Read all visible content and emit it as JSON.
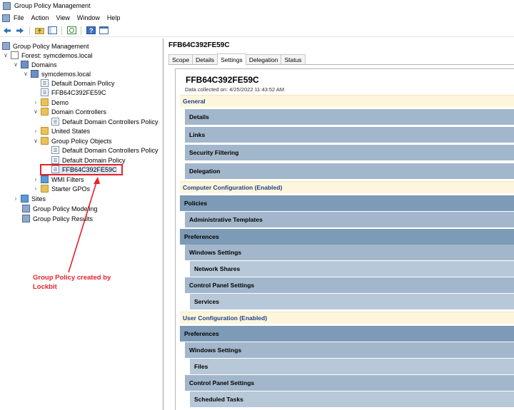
{
  "app": {
    "title": "Group Policy Management"
  },
  "menu": [
    "File",
    "Action",
    "View",
    "Window",
    "Help"
  ],
  "toolbar": {
    "icons": [
      "back-icon",
      "forward-icon",
      "up-folder-icon",
      "show-tree-icon",
      "refresh-icon",
      "help-icon",
      "properties-icon"
    ]
  },
  "tree": {
    "root": "Group Policy Management",
    "forest": "Forest: symcdemos.local",
    "domains": "Domains",
    "domain": "symcdemos.local",
    "default_domain_policy": "Default Domain Policy",
    "gpo_link": "FFB64C392FE59C",
    "demo": "Demo",
    "domain_controllers": "Domain Controllers",
    "default_dc_policy": "Default Domain Controllers Policy",
    "united_states": "United States",
    "gpo_container": "Group Policy Objects",
    "gpo_dc_policy": "Default Domain Controllers Policy",
    "gpo_domain_policy": "Default Domain Policy",
    "gpo_selected": "FFB64C392FE59C",
    "wmi_filters": "WMI Filters",
    "starter_gpos": "Starter GPOs",
    "sites": "Sites",
    "modeling": "Group Policy Modeling",
    "results": "Group Policy Results"
  },
  "annotation": {
    "text": "Group Policy created by Lockbit",
    "color": "#e8202a"
  },
  "detail": {
    "title": "FFB64C392FE59C",
    "tabs": [
      "Scope",
      "Details",
      "Settings",
      "Delegation",
      "Status"
    ],
    "active_tab": "Settings",
    "report_title": "FFB64C392FE59C",
    "data_collected": "Data collected on: 4/25/2022 11:43:52 AM",
    "general": "General",
    "details": "Details",
    "links": "Links",
    "security_filtering": "Security Filtering",
    "delegation": "Delegation",
    "computer_config": "Computer Configuration (Enabled)",
    "policies": "Policies",
    "admin_templates": "Administrative Templates",
    "preferences": "Preferences",
    "windows_settings": "Windows Settings",
    "network_shares": "Network Shares",
    "control_panel": "Control Panel Settings",
    "services": "Services",
    "user_config": "User Configuration (Enabled)",
    "u_preferences": "Preferences",
    "u_windows_settings": "Windows Settings",
    "files": "Files",
    "u_control_panel": "Control Panel Settings",
    "scheduled_tasks": "Scheduled Tasks"
  },
  "colors": {
    "section_bg": "#fdf6dc",
    "section_text": "#1f3e8a",
    "bar": "#a3b7cc",
    "bar_dark": "#7d9ab6",
    "bar_light": "#b7c8d8"
  }
}
